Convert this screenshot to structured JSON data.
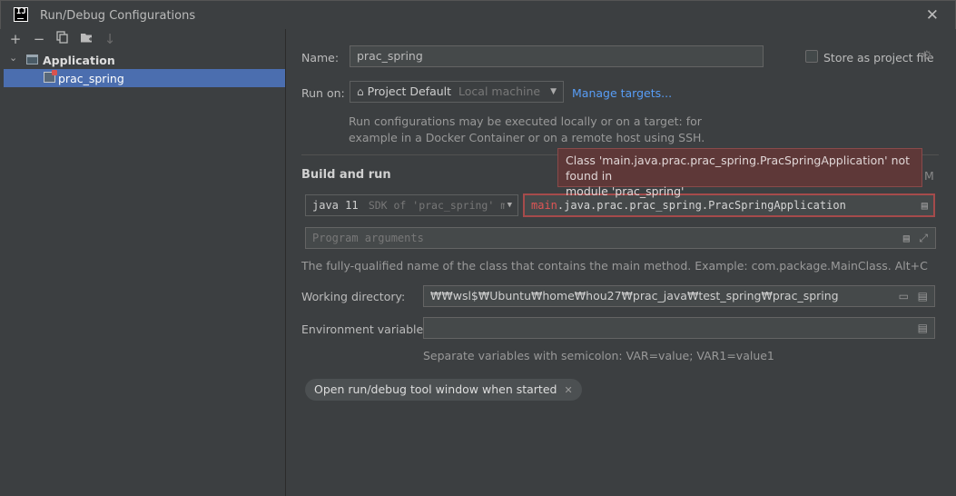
{
  "window": {
    "title": "Run/Debug Configurations",
    "logo_text": "IJ"
  },
  "left": {
    "toolbar": [
      "add-icon",
      "remove-icon",
      "copy-icon",
      "new-folder-icon",
      "sort-icon"
    ],
    "tree": {
      "group_label": "Application",
      "selected_item": "prac_spring"
    }
  },
  "form": {
    "name_label": "Name:",
    "name_value": "prac_spring",
    "store_label": "Store as project file",
    "run_on_label": "Run on:",
    "run_on_value": "Project Default",
    "run_on_hint": "Local machine",
    "manage_targets": "Manage targets...",
    "run_on_note_1": "Run configurations may be executed locally or on a target: for",
    "run_on_note_2": "example in a Docker Container or on a remote host using SSH.",
    "build_run_title": "Build and run",
    "modify_hint": "M",
    "sdk_value": "java 11",
    "sdk_hint": "SDK of 'prac_spring' m",
    "main_class_error_part": "main",
    "main_class_rest": ".java.prac.prac_spring.PracSpringApplication",
    "program_args_placeholder": "Program arguments",
    "main_class_note": "The fully-qualified name of the class that contains the main method. Example: com.package.MainClass. Alt+C",
    "workdir_label": "Working directory:",
    "workdir_value": "₩₩wsl$₩Ubuntu₩home₩hou27₩prac_java₩test_spring₩prac_spring",
    "env_label": "Environment variables:",
    "env_value": "",
    "env_note": "Separate variables with semicolon: VAR=value; VAR1=value1",
    "tool_window_pill": "Open run/debug tool window when started",
    "tooltip_line_1": "Class 'main.java.prac.prac_spring.PracSpringApplication' not found in",
    "tooltip_line_2": "module 'prac_spring'"
  },
  "colors": {
    "error": "#d9534f",
    "link": "#589df6",
    "selection": "#4b6eaf"
  }
}
